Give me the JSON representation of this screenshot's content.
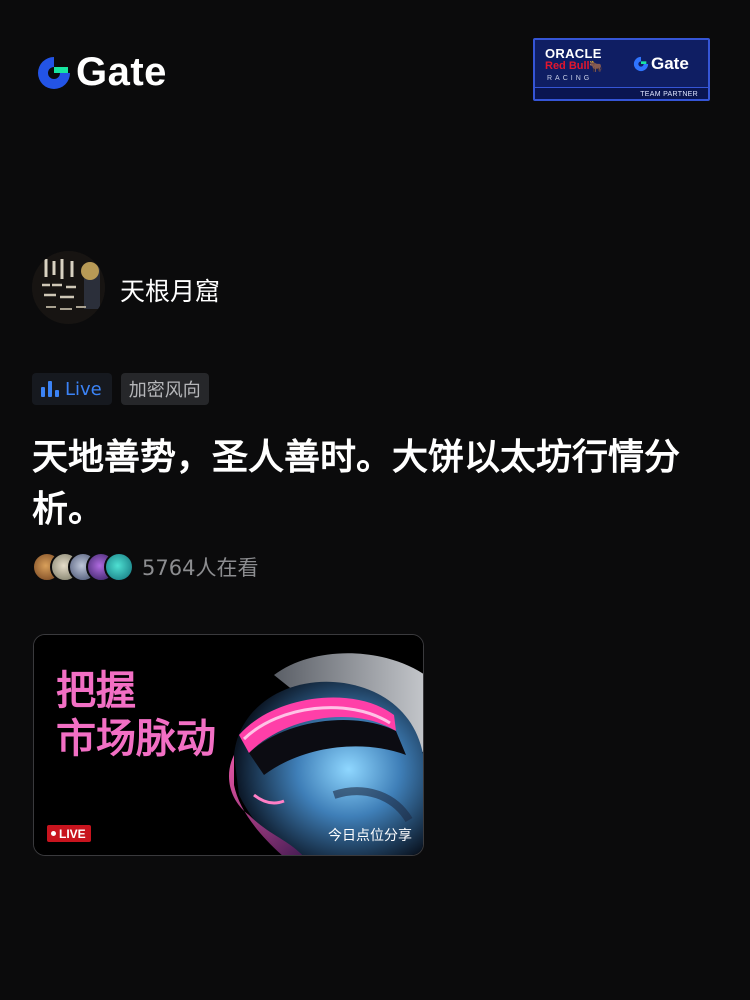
{
  "header": {
    "brand": "Gate",
    "partner": {
      "oracle": "ORACLE",
      "redbull": "Red Bull",
      "racing": "RACING",
      "gate": "Gate",
      "label": "TEAM PARTNER"
    }
  },
  "author": {
    "name": "天根月窟"
  },
  "tags": {
    "live": "Live",
    "category": "加密风向"
  },
  "post": {
    "title": "天地善势，圣人善时。大饼以太坊行情分析。",
    "viewers": "5764人在看"
  },
  "cover": {
    "title_line1": "把握",
    "title_line2": "市场脉动",
    "live_badge": "LIVE",
    "caption": "今日点位分享"
  },
  "colors": {
    "background": "#0b0b0c",
    "gate_blue": "#2354e6",
    "gate_green": "#17e6a1",
    "live_blue": "#3b83f6",
    "cover_pink": "#f26fc4",
    "live_red": "#c8141e"
  },
  "icons": {
    "brand": "gate-logo-icon",
    "live": "bar-chart-icon"
  }
}
